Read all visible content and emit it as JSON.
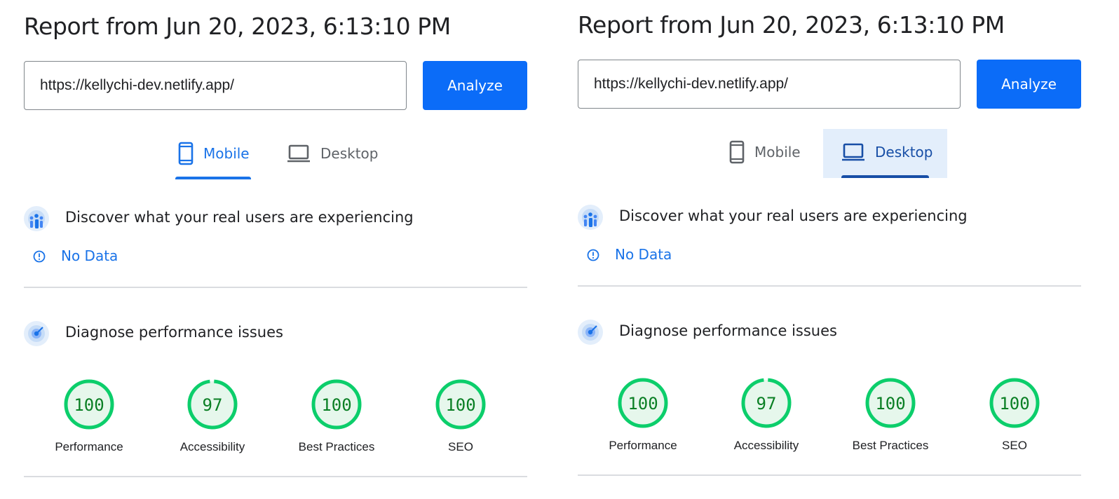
{
  "panels": [
    {
      "report_title": "Report from Jun 20, 2023, 6:13:10 PM",
      "url_value": "https://kellychi-dev.netlify.app/",
      "analyze_label": "Analyze",
      "tabs": [
        {
          "label": "Mobile",
          "state": "selected"
        },
        {
          "label": "Desktop",
          "state": "unselected"
        }
      ],
      "field_section_title": "Discover what your real users are experiencing",
      "no_data_label": "No Data",
      "lab_section_title": "Diagnose performance issues",
      "scores": [
        {
          "label": "Performance",
          "score": "100"
        },
        {
          "label": "Accessibility",
          "score": "97"
        },
        {
          "label": "Best Practices",
          "score": "100"
        },
        {
          "label": "SEO",
          "score": "100"
        }
      ]
    },
    {
      "report_title": "Report from Jun 20, 2023, 6:13:10 PM",
      "url_value": "https://kellychi-dev.netlify.app/",
      "analyze_label": "Analyze",
      "tabs": [
        {
          "label": "Mobile",
          "state": "unselected"
        },
        {
          "label": "Desktop",
          "state": "selected-hover"
        }
      ],
      "field_section_title": "Discover what your real users are experiencing",
      "no_data_label": "No Data",
      "lab_section_title": "Diagnose performance issues",
      "scores": [
        {
          "label": "Performance",
          "score": "100"
        },
        {
          "label": "Accessibility",
          "score": "97"
        },
        {
          "label": "Best Practices",
          "score": "100"
        },
        {
          "label": "SEO",
          "score": "100"
        }
      ]
    }
  ],
  "icons": {
    "mobile": "smartphone-icon",
    "desktop": "laptop-icon",
    "field_section": "users-experience-icon",
    "lab_section": "radar-icon",
    "no_data": "info-circle-icon"
  },
  "colors": {
    "accent": "#1a73e8",
    "analyze_button": "#0b6cf8",
    "score_pass_ring": "#0cce6b",
    "score_pass_fill": "#e6f7ec",
    "score_pass_text": "#0a7f24",
    "divider": "#dadce0"
  }
}
